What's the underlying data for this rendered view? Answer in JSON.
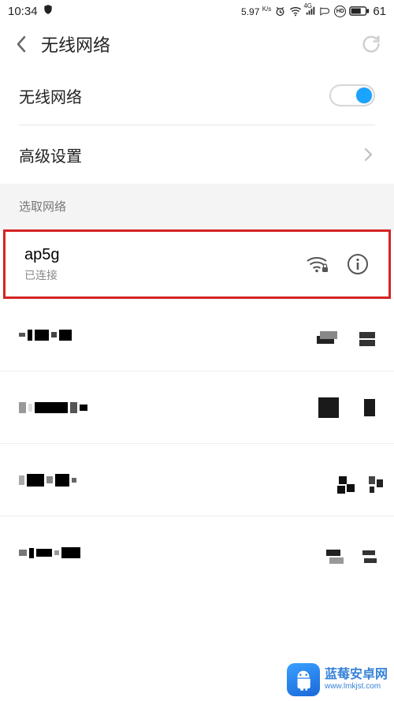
{
  "status": {
    "time": "10:34",
    "speed": "5.97",
    "speedUnit": "K/s",
    "network": "4G",
    "hd": "HD",
    "battery": "61"
  },
  "header": {
    "title": "无线网络"
  },
  "rows": {
    "wifiToggleLabel": "无线网络",
    "advancedLabel": "高级设置"
  },
  "section": {
    "chooseNetwork": "选取网络"
  },
  "networks": {
    "connected": {
      "name": "ap5g",
      "status": "已连接"
    }
  },
  "watermark": {
    "line1": "蓝莓安卓网",
    "line2": "www.lmkjst.com"
  }
}
